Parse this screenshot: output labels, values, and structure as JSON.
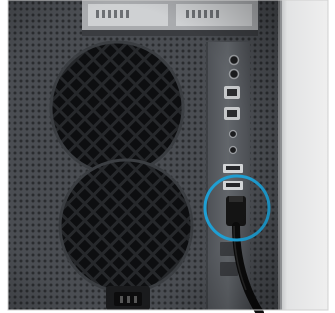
{
  "image": {
    "subject": "computer-tower-rear-panel",
    "colors": {
      "frame_background": "#ffffff",
      "chassis_metal": "#4e5156",
      "grille_dark": "#1a1b1d",
      "panel_strip": "#5b5f64",
      "highlight_circle": "#1f9fd3",
      "cable": "#0b0b0b",
      "side_wall": "#e3e3e3"
    },
    "highlight": "usb-port-with-cable"
  }
}
